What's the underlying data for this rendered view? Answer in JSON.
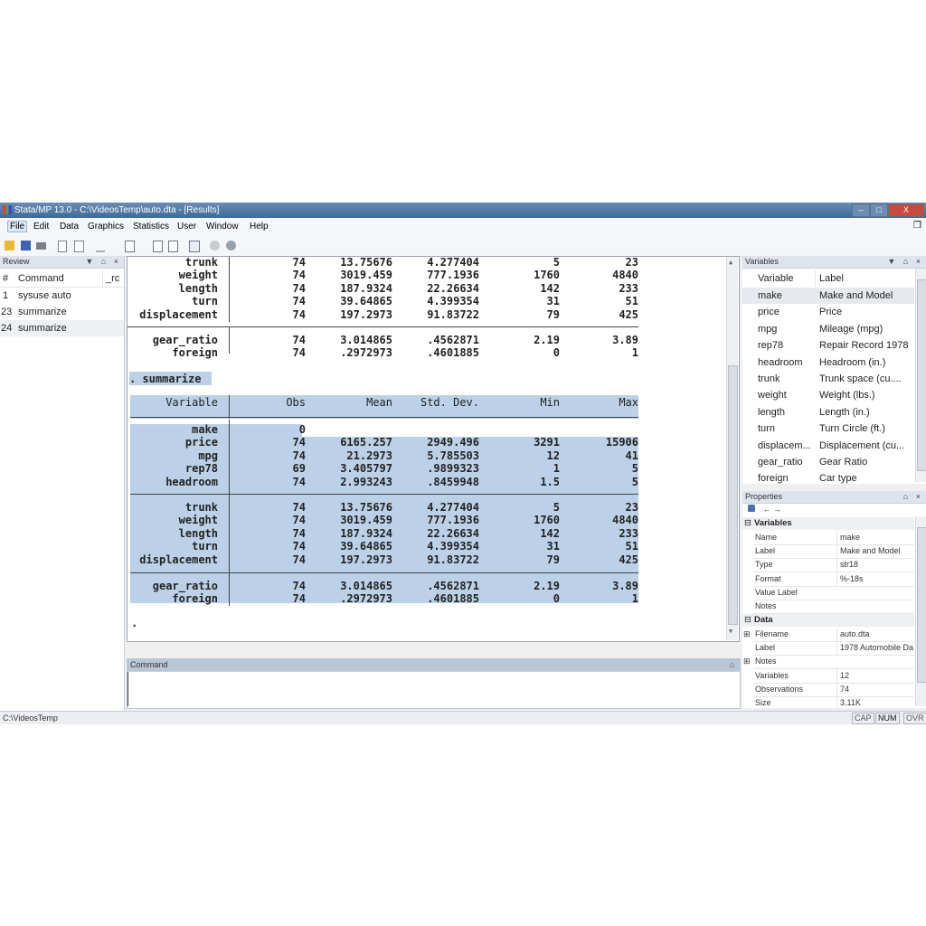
{
  "window": {
    "title": "Stata/MP 13.0 - C:\\VideosTemp\\auto.dta - [Results]",
    "minimize": "–",
    "restore": "□",
    "close": "X",
    "mdi_restore": "❐"
  },
  "menu": [
    "File",
    "Edit",
    "Data",
    "Graphics",
    "Statistics",
    "User",
    "Window",
    "Help"
  ],
  "toolbar": {
    "icons": [
      "open-icon",
      "save-icon",
      "print-icon",
      "log-icon",
      "viewer-icon",
      "graph-icon",
      "do-file-editor-icon",
      "data-editor-icon",
      "data-browser-icon",
      "variables-manager-icon",
      "more-icon",
      "break-icon"
    ]
  },
  "review": {
    "title": "Review",
    "controls": "▼ ⌂ ×",
    "columns": [
      "#",
      "Command",
      "_rc"
    ],
    "rows": [
      {
        "num": "1",
        "cmd": "sysuse auto"
      },
      {
        "num": "23",
        "cmd": "summarize"
      },
      {
        "num": "24",
        "cmd": "summarize"
      }
    ]
  },
  "results": {
    "top_rows": [
      {
        "var": "trunk",
        "obs": "74",
        "mean": "13.75676",
        "sd": "4.277404",
        "min": "5",
        "max": "23"
      },
      {
        "var": "weight",
        "obs": "74",
        "mean": "3019.459",
        "sd": "777.1936",
        "min": "1760",
        "max": "4840"
      },
      {
        "var": "length",
        "obs": "74",
        "mean": "187.9324",
        "sd": "22.26634",
        "min": "142",
        "max": "233"
      },
      {
        "var": "turn",
        "obs": "74",
        "mean": "39.64865",
        "sd": "4.399354",
        "min": "31",
        "max": "51"
      },
      {
        "var": "displacement",
        "obs": "74",
        "mean": "197.2973",
        "sd": "91.83722",
        "min": "79",
        "max": "425"
      },
      {
        "var": "gear_ratio",
        "obs": "74",
        "mean": "3.014865",
        "sd": ".4562871",
        "min": "2.19",
        "max": "3.89"
      },
      {
        "var": "foreign",
        "obs": "74",
        "mean": ".2972973",
        "sd": ".4601885",
        "min": "0",
        "max": "1"
      }
    ],
    "command_echo": ". summarize",
    "headers": {
      "var": "Variable",
      "obs": "Obs",
      "mean": "Mean",
      "sd": "Std. Dev.",
      "min": "Min",
      "max": "Max"
    },
    "rows": [
      {
        "var": "make",
        "obs": "0",
        "mean": "",
        "sd": "",
        "min": "",
        "max": ""
      },
      {
        "var": "price",
        "obs": "74",
        "mean": "6165.257",
        "sd": "2949.496",
        "min": "3291",
        "max": "15906"
      },
      {
        "var": "mpg",
        "obs": "74",
        "mean": "21.2973",
        "sd": "5.785503",
        "min": "12",
        "max": "41"
      },
      {
        "var": "rep78",
        "obs": "69",
        "mean": "3.405797",
        "sd": ".9899323",
        "min": "1",
        "max": "5"
      },
      {
        "var": "headroom",
        "obs": "74",
        "mean": "2.993243",
        "sd": ".8459948",
        "min": "1.5",
        "max": "5"
      },
      {
        "var": "trunk",
        "obs": "74",
        "mean": "13.75676",
        "sd": "4.277404",
        "min": "5",
        "max": "23"
      },
      {
        "var": "weight",
        "obs": "74",
        "mean": "3019.459",
        "sd": "777.1936",
        "min": "1760",
        "max": "4840"
      },
      {
        "var": "length",
        "obs": "74",
        "mean": "187.9324",
        "sd": "22.26634",
        "min": "142",
        "max": "233"
      },
      {
        "var": "turn",
        "obs": "74",
        "mean": "39.64865",
        "sd": "4.399354",
        "min": "31",
        "max": "51"
      },
      {
        "var": "displacement",
        "obs": "74",
        "mean": "197.2973",
        "sd": "91.83722",
        "min": "79",
        "max": "425"
      },
      {
        "var": "gear_ratio",
        "obs": "74",
        "mean": "3.014865",
        "sd": ".4562871",
        "min": "2.19",
        "max": "3.89"
      },
      {
        "var": "foreign",
        "obs": "74",
        "mean": ".2972973",
        "sd": ".4601885",
        "min": "0",
        "max": "1"
      }
    ],
    "prompt": "."
  },
  "command": {
    "title": "Command",
    "pin": "⌂",
    "value": ""
  },
  "variables": {
    "title": "Variables",
    "controls": "▼ ⌂ ×",
    "columns": [
      "Variable",
      "Label"
    ],
    "rows": [
      {
        "name": "make",
        "label": "Make and Model"
      },
      {
        "name": "price",
        "label": "Price"
      },
      {
        "name": "mpg",
        "label": "Mileage (mpg)"
      },
      {
        "name": "rep78",
        "label": "Repair Record 1978"
      },
      {
        "name": "headroom",
        "label": "Headroom (in.)"
      },
      {
        "name": "trunk",
        "label": "Trunk space (cu...."
      },
      {
        "name": "weight",
        "label": "Weight (lbs.)"
      },
      {
        "name": "length",
        "label": "Length (in.)"
      },
      {
        "name": "turn",
        "label": "Turn Circle (ft.)"
      },
      {
        "name": "displacem...",
        "label": "Displacement (cu..."
      },
      {
        "name": "gear_ratio",
        "label": "Gear Ratio"
      },
      {
        "name": "foreign",
        "label": "Car type"
      }
    ]
  },
  "properties": {
    "title": "Properties",
    "controls": "⌂ ×",
    "toolbar": {
      "lock": "🔒",
      "back": "←",
      "forward": "→"
    },
    "variables_section": {
      "title": "Variables",
      "rows": [
        {
          "key": "Name",
          "value": "make"
        },
        {
          "key": "Label",
          "value": "Make and Model"
        },
        {
          "key": "Type",
          "value": "str18"
        },
        {
          "key": "Format",
          "value": "%-18s"
        },
        {
          "key": "Value Label",
          "value": ""
        },
        {
          "key": "Notes",
          "value": ""
        }
      ]
    },
    "data_section": {
      "title": "Data",
      "rows": [
        {
          "key": "Filename",
          "value": "auto.dta",
          "expand": true
        },
        {
          "key": "Label",
          "value": "1978 Automobile Da",
          "expand": false
        },
        {
          "key": "Notes",
          "value": "",
          "expand": true
        },
        {
          "key": "Variables",
          "value": "12",
          "expand": false
        },
        {
          "key": "Observations",
          "value": "74",
          "expand": false
        },
        {
          "key": "Size",
          "value": "3.11K",
          "expand": false
        }
      ]
    }
  },
  "status": {
    "path": "C:\\VideosTemp",
    "cap": "CAP",
    "num": "NUM",
    "ovr": "OVR"
  }
}
